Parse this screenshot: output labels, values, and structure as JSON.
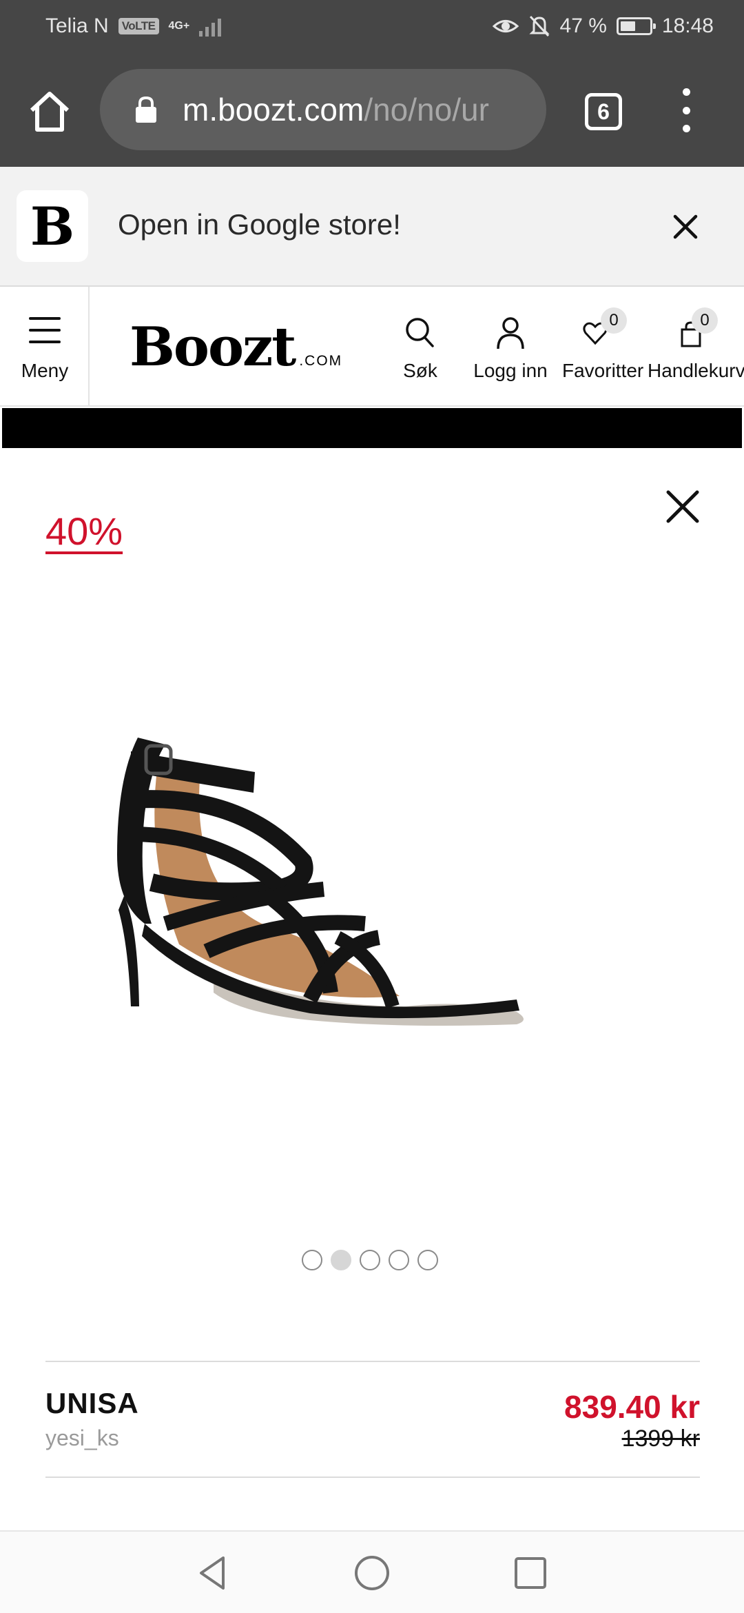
{
  "status_bar": {
    "carrier": "Telia N",
    "volte": "VoLTE",
    "network": "4G+",
    "battery": "47 %",
    "time": "18:48"
  },
  "browser": {
    "url_host": "m.boozt.com",
    "url_path": "/no/no/ur",
    "tab_count": "6"
  },
  "app_banner": {
    "logo_letter": "B",
    "text": "Open in Google store!"
  },
  "header": {
    "menu_label": "Meny",
    "brand_name": "Boozt",
    "brand_suffix": ".COM",
    "search_label": "Søk",
    "login_label": "Logg inn",
    "favorites_label": "Favoritter",
    "favorites_count": "0",
    "cart_label": "Handlekurv",
    "cart_count": "0"
  },
  "product": {
    "discount": "40%",
    "brand": "UNISA",
    "seller": "yesi_ks",
    "price": "839.40 kr",
    "old_price": "1399 kr",
    "carousel": {
      "total": 5,
      "active_index": 1
    }
  },
  "colors": {
    "chrome_bg": "#464646",
    "sale_red": "#d0122c",
    "banner_bg": "#f2f2f2"
  }
}
